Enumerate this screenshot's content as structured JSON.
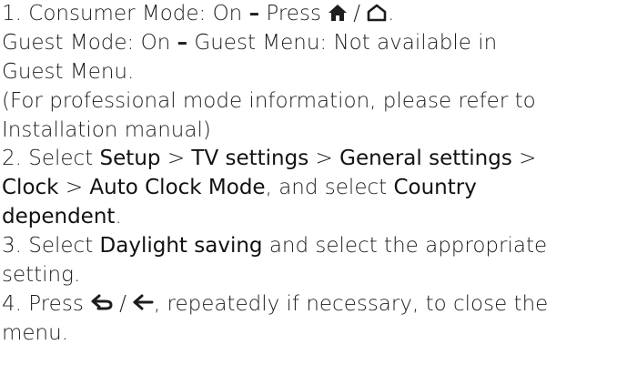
{
  "step1": {
    "num": "1.",
    "consumer_label": "Consumer Mode: On",
    "dash": "–",
    "press": "Press",
    "slash": "/",
    "end": ".",
    "icons": [
      "home-filled-icon",
      "home-outline-icon"
    ]
  },
  "guest": {
    "line_a_1": "Guest Mode: On",
    "dash": "–",
    "line_a_2": "Guest Menu: Not available in",
    "line_b": "Guest Menu."
  },
  "professional": {
    "line_a": "(For professional mode information, please refer to",
    "line_b": "Installation manual)"
  },
  "step2": {
    "num": "2.",
    "select": "Select",
    "setup": "Setup",
    "gt": ">",
    "tv_settings": "TV settings",
    "general_settings": "General settings",
    "clock": "Clock",
    "auto_clock_mode": "Auto Clock Mode",
    "and_select": ", and select",
    "country": "Country",
    "dependent": "dependent",
    "end": "."
  },
  "step3": {
    "num": "3.",
    "select": "Select",
    "daylight_saving": "Daylight saving",
    "rest_a": "and select the appropriate",
    "rest_b": "setting."
  },
  "step4": {
    "num": "4.",
    "press": "Press",
    "slash": "/",
    "rest_a": ", repeatedly if necessary, to close the",
    "rest_b": "menu.",
    "icons": [
      "back-icon",
      "back-arrow-icon"
    ]
  }
}
